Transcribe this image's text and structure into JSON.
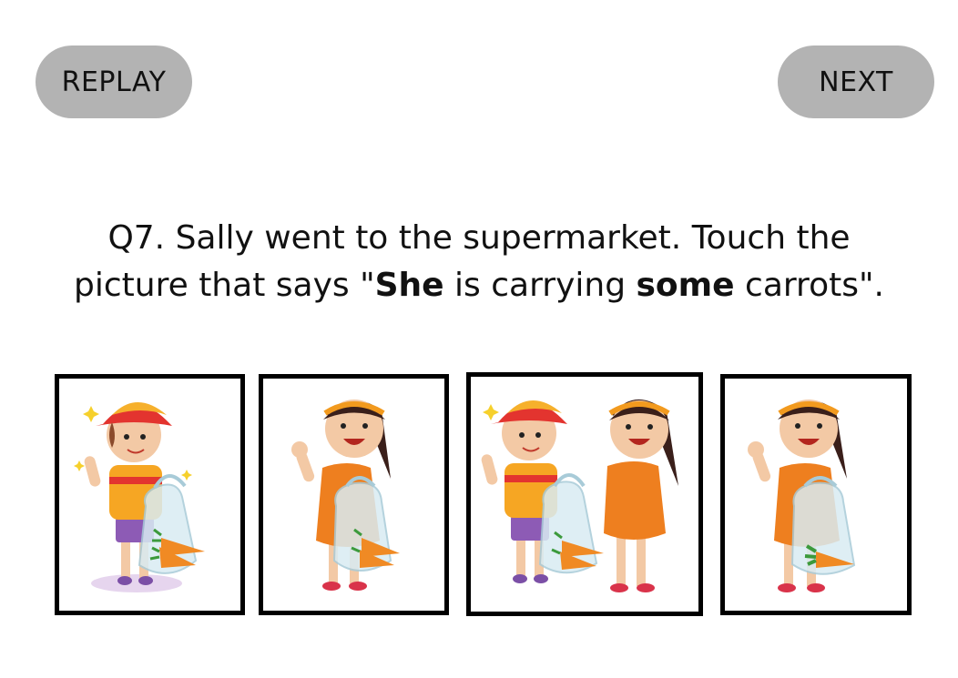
{
  "buttons": {
    "replay_label": "REPLAY",
    "next_label": "NEXT"
  },
  "question": {
    "line1": "Q7. Sally went to the supermarket. Touch the",
    "line2_a": "picture that says \"",
    "line2_b": "She",
    "line2_c": " is carrying ",
    "line2_d": "some",
    "line2_e": " carrots\"."
  },
  "options": [
    {
      "icon": "boy-carrots-icon"
    },
    {
      "icon": "girl-carrots-icon"
    },
    {
      "icon": "boy-and-girl-carrots-icon"
    },
    {
      "icon": "girl-carrot-icon"
    }
  ],
  "colors": {
    "button_bg": "#b3b3b3",
    "cap_red": "#e3342f",
    "cap_yellow": "#f6b02c",
    "dress_orange": "#ee7f1f",
    "carrot": "#f08a24"
  }
}
